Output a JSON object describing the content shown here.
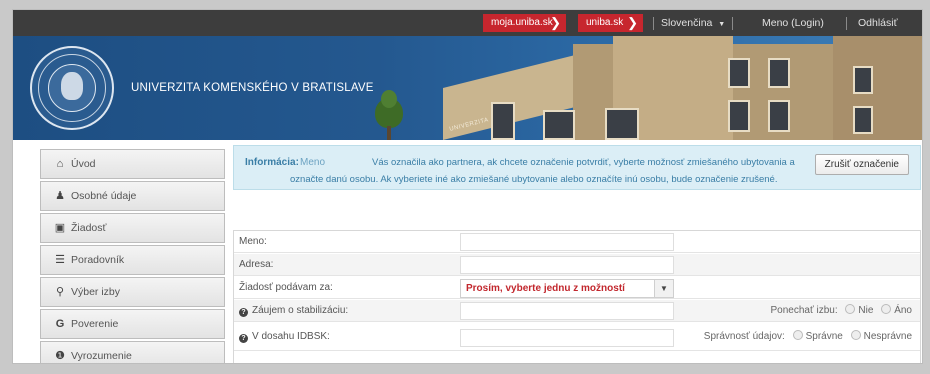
{
  "topbar": {
    "moja_uniba": "moja.uniba.sk",
    "uniba": "uniba.sk",
    "language": "Slovenčina",
    "login": "Meno (Login)",
    "logout": "Odhlásiť"
  },
  "banner": {
    "university_name": "UNIVERZITA KOMENSKÉHO V BRATISLAVE",
    "building_sign": "UNIVERZITA"
  },
  "sidebar": {
    "items": [
      {
        "label": "Úvod",
        "icon": "home-icon"
      },
      {
        "label": "Osobné údaje",
        "icon": "user-icon"
      },
      {
        "label": "Žiadosť",
        "icon": "card-icon"
      },
      {
        "label": "Poradovník",
        "icon": "list-icon"
      },
      {
        "label": "Výber izby",
        "icon": "bulb-icon"
      },
      {
        "label": "Poverenie",
        "icon": "g-icon"
      },
      {
        "label": "Vyrozumenie",
        "icon": "info-icon"
      }
    ]
  },
  "info": {
    "title": "Informácia:",
    "name": "Meno",
    "text1": "Vás označila ako partnera, ak chcete označenie potvrdiť, vyberte možnosť zmiešaného ubytovania a",
    "text2": "označte danú osobu. Ak vyberiete iné ako zmiešané ubytovanie alebo označíte inú osobu, bude označenie zrušené.",
    "button": "Zrušiť označenie"
  },
  "form": {
    "meno_label": "Meno:",
    "adresa_label": "Adresa:",
    "ziadost_label": "Žiadosť podávam za:",
    "ziadost_value": "Prosím, vyberte jednu z možností",
    "stabilizacia_label": "Záujem o stabilizáciu:",
    "ponechat_label": "Ponechať izbu:",
    "nie": "Nie",
    "ano": "Áno",
    "dosah_label": "V dosahu IDBSK:",
    "spravnost_label": "Správnosť údajov:",
    "spravne": "Správne",
    "nespravne": "Nesprávne"
  },
  "colors": {
    "topbar": "#3d3d3d",
    "red_button": "#c7262e",
    "banner_blue": "#24588f",
    "info_bg": "#dbeef6",
    "select_text": "#c2272d"
  }
}
